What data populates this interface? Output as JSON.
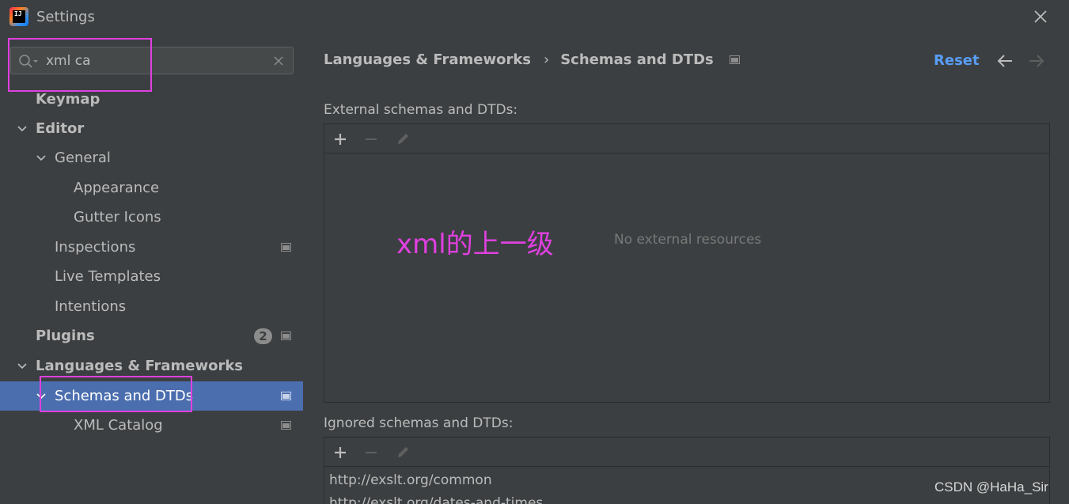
{
  "window": {
    "title": "Settings",
    "logo_text": "IJ"
  },
  "search": {
    "value": "xml ca"
  },
  "sidebar": {
    "items": [
      {
        "label": "Keymap"
      },
      {
        "label": "Editor"
      },
      {
        "label": "General"
      },
      {
        "label": "Appearance"
      },
      {
        "label": "Gutter Icons"
      },
      {
        "label": "Inspections"
      },
      {
        "label": "Live Templates"
      },
      {
        "label": "Intentions"
      },
      {
        "label": "Plugins",
        "badge": "2"
      },
      {
        "label": "Languages & Frameworks"
      },
      {
        "label": "Schemas and DTDs"
      },
      {
        "label": "XML Catalog"
      }
    ]
  },
  "header": {
    "crumb1": "Languages & Frameworks",
    "separator": "›",
    "crumb2": "Schemas and DTDs",
    "reset": "Reset"
  },
  "external": {
    "label": "External schemas and DTDs:",
    "empty": "No external resources"
  },
  "ignored": {
    "label": "Ignored schemas and DTDs:",
    "rows": [
      "http://exslt.org/common",
      "http://exslt.org/dates-and-times"
    ]
  },
  "annotation": "xml的上一级",
  "watermark": "CSDN @HaHa_Sir",
  "colors": {
    "selection": "#4b6eaf",
    "link": "#589df6",
    "annotation": "#e040e0"
  }
}
